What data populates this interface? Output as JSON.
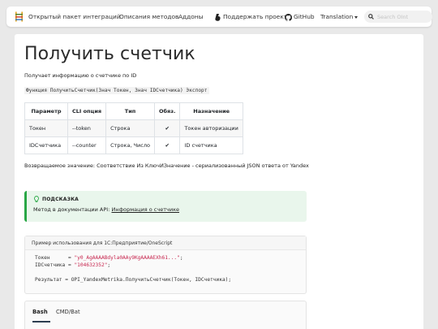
{
  "nav": {
    "logo_icon": "ladder-logo-icon",
    "items": [
      {
        "label": "Открытый пакет интеграций"
      },
      {
        "label": "Описания методов"
      },
      {
        "label": "Аддоны"
      },
      {
        "label": "Поддержать проект",
        "icon": "boosty-icon"
      },
      {
        "label": "GitHub",
        "icon": "github-icon"
      },
      {
        "label": "Translation"
      }
    ],
    "search_placeholder": "Search OInt"
  },
  "page": {
    "title": "Получить счетчик",
    "description": "Получает информацию о счетчике по ID",
    "signature": "Функция ПолучитьСчетчик(Знач Токен, Знач IDСчетчика) Экспорт",
    "table": {
      "headers": [
        "Параметр",
        "CLI опция",
        "Тип",
        "Обяз.",
        "Назначение"
      ],
      "rows": [
        [
          "Токен",
          "--token",
          "Строка",
          "✔",
          "Токен авторизации"
        ],
        [
          "IDСчетчика",
          "--counter",
          "Строка, Число",
          "✔",
          "ID счетчика"
        ]
      ]
    },
    "return_text": "Возвращаемое значение: Соответствие Из КлючИЗначение - сериализованный JSON ответа от Yandex",
    "tip": {
      "title": "ПОДСКАЗКА",
      "body_prefix": "Метод в документации API: ",
      "link_label": "Информация о счетчике"
    },
    "example": {
      "title": "Пример использования для 1С:Предприятие/OneScript",
      "line1_var": "Токен      = ",
      "line1_val": "\"y0_AgAAAABdyla0AAy9KgAAAAEXh61...\"",
      "line2_var": "IDСчетчика = ",
      "line2_val": "\"104632352\"",
      "line4": "Результат = OPI_YandexMetrika.ПолучитьСчетчик(Токен, IDСчетчика);",
      "semicolon": ";"
    },
    "tabs": [
      {
        "label": "Bash",
        "active": true
      },
      {
        "label": "CMD/Bat",
        "active": false
      }
    ]
  },
  "colors": {
    "tip_border": "#28a745",
    "tip_bg": "#e9f6ec",
    "string": "#c7254e"
  }
}
